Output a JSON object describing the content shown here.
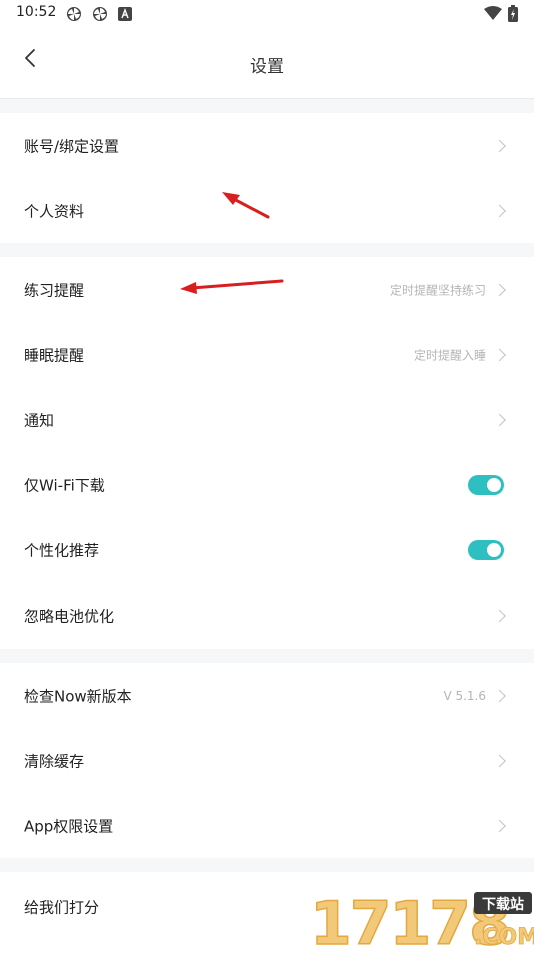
{
  "status_bar": {
    "time": "10:52",
    "icons": [
      "pinwheel-icon",
      "pinwheel-icon",
      "a-box-icon",
      "wifi-icon",
      "battery-charging-icon"
    ]
  },
  "header": {
    "title": "设置",
    "back_icon": "chevron-left-icon"
  },
  "sections": [
    {
      "rows": [
        {
          "label": "账号/绑定设置",
          "value": "",
          "control": "chevron"
        },
        {
          "label": "个人资料",
          "value": "",
          "control": "chevron"
        }
      ]
    },
    {
      "rows": [
        {
          "label": "练习提醒",
          "value": "定时提醒坚持练习",
          "control": "chevron"
        },
        {
          "label": "睡眠提醒",
          "value": "定时提醒入睡",
          "control": "chevron"
        },
        {
          "label": "通知",
          "value": "",
          "control": "chevron"
        },
        {
          "label": "仅Wi-Fi下载",
          "value": "",
          "control": "toggle",
          "on": true
        },
        {
          "label": "个性化推荐",
          "value": "",
          "control": "toggle",
          "on": true
        },
        {
          "label": "忽略电池优化",
          "value": "",
          "control": "chevron"
        }
      ]
    },
    {
      "rows": [
        {
          "label": "检查Now新版本",
          "value": "V 5.1.6",
          "control": "chevron"
        },
        {
          "label": "清除缓存",
          "value": "",
          "control": "chevron"
        },
        {
          "label": "App权限设置",
          "value": "",
          "control": "chevron"
        }
      ]
    },
    {
      "rows": [
        {
          "label": "给我们打分",
          "value": "",
          "control": "chevron"
        }
      ]
    }
  ],
  "watermark": {
    "text": "17178",
    "badge": "下载站",
    "domain": ".COM"
  },
  "colors": {
    "toggle_on": "#2ebfc0",
    "section_gap": "#f6f7f9",
    "annotation_arrow": "#d81e1e"
  }
}
